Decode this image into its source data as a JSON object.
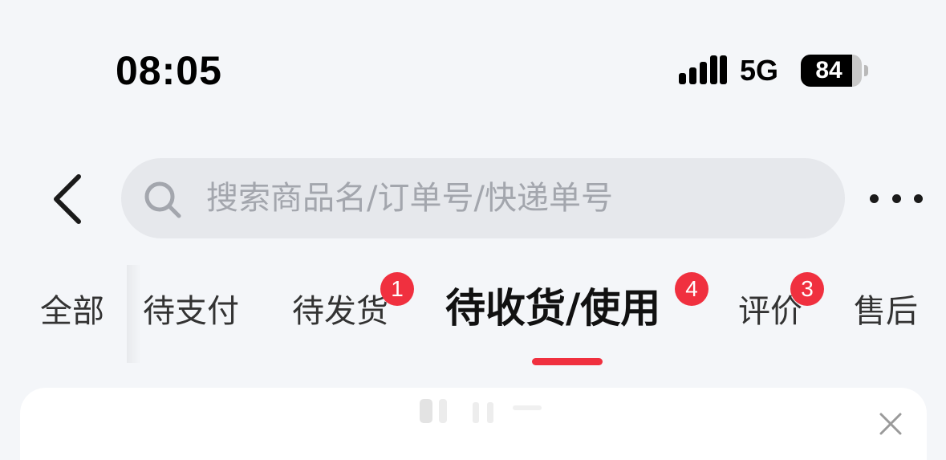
{
  "status_bar": {
    "time": "08:05",
    "network": "5G",
    "battery_level": "84",
    "battery_fraction": 0.84,
    "signal_icon": "signal-bars-icon"
  },
  "header": {
    "back_icon": "chevron-left-icon",
    "search": {
      "icon": "search-icon",
      "placeholder": "搜索商品名/订单号/快递单号",
      "value": ""
    },
    "more_icon": "more-dots-icon"
  },
  "tabs": [
    {
      "label": "全部",
      "badge": ""
    },
    {
      "label": "待支付",
      "badge": ""
    },
    {
      "label": "待发货",
      "badge": "1"
    },
    {
      "label": "待收货/使用",
      "badge": "4",
      "active": true
    },
    {
      "label": "评价",
      "badge": "3"
    },
    {
      "label": "售后",
      "badge": ""
    }
  ],
  "colors": {
    "background": "#f4f6f9",
    "accent": "#f0303f",
    "search_bg": "#e6e8ec",
    "placeholder": "#a3a6ad"
  },
  "card": {
    "close_icon": "close-icon"
  }
}
